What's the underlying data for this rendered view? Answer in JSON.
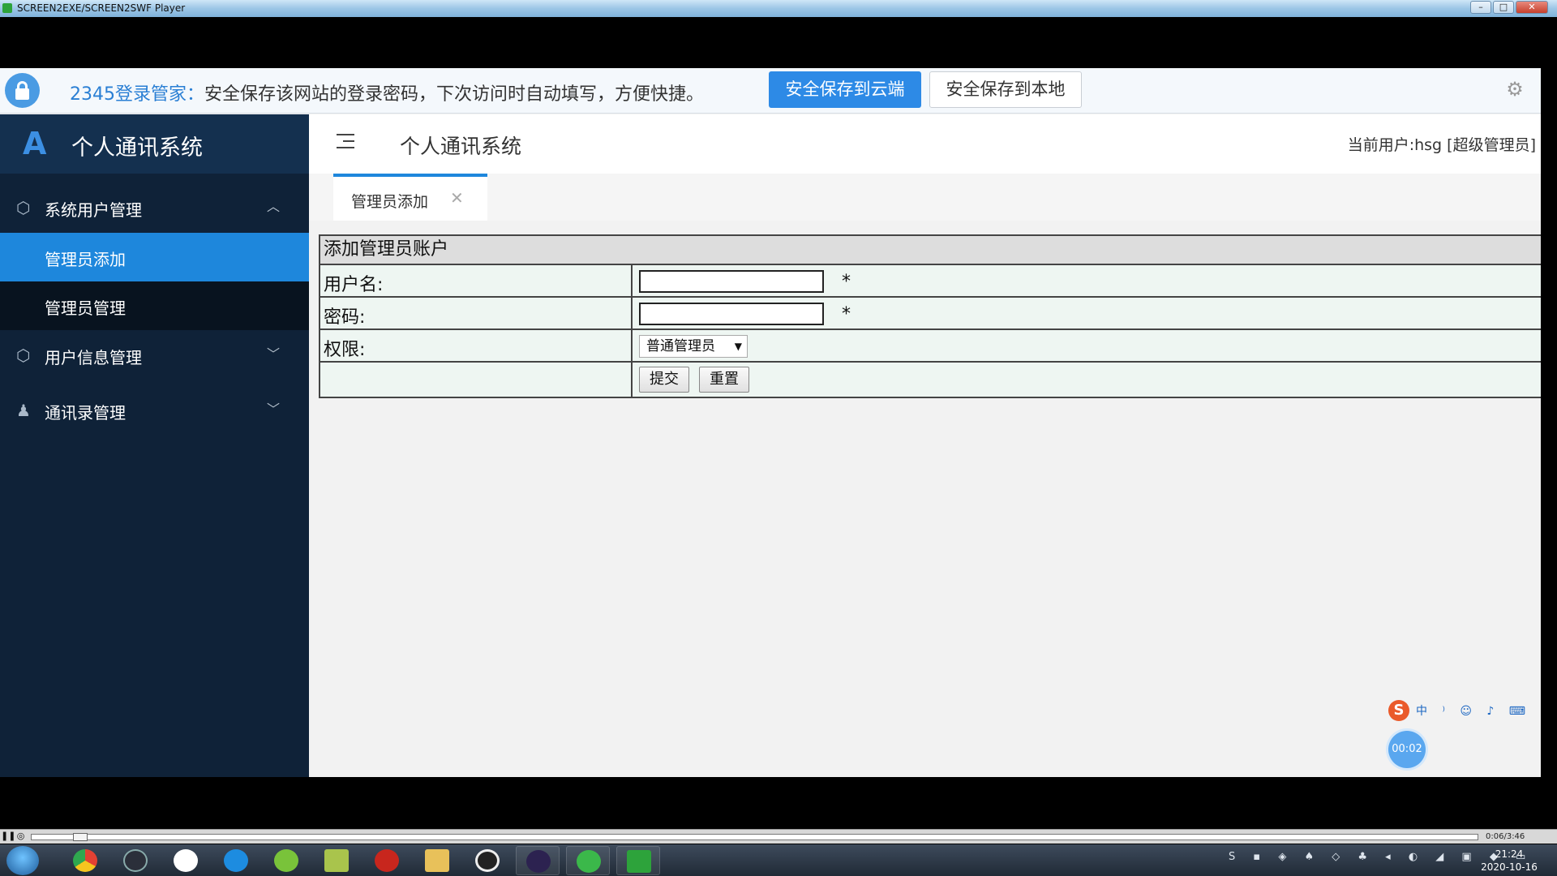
{
  "window": {
    "title": "SCREEN2EXE/SCREEN2SWF Player",
    "min": "–",
    "max": "□",
    "close": "✕"
  },
  "password_bar": {
    "brand": "2345登录管家：",
    "message": "安全保存该网站的登录密码，下次访问时自动填写，方便快捷。",
    "save_cloud": "安全保存到云端",
    "save_local": "安全保存到本地",
    "gear_glyph": "⚙"
  },
  "sidebar": {
    "logo_mark": "A",
    "logo_text": "个人通讯系统",
    "groups": [
      {
        "label": "系统用户管理",
        "icon": "cube-icon",
        "expanded": true
      },
      {
        "label": "用户信息管理",
        "icon": "cube-icon",
        "expanded": false
      },
      {
        "label": "通讯录管理",
        "icon": "user-icon",
        "expanded": false
      }
    ],
    "sub_items": [
      {
        "label": "管理员添加",
        "active": true
      },
      {
        "label": "管理员管理",
        "active": false
      }
    ],
    "arrow_up": "︿",
    "arrow_down": "﹀"
  },
  "topnav": {
    "title": "个人通讯系统",
    "current_user": "当前用户:hsg [超级管理员]"
  },
  "tabs": [
    {
      "label": "管理员添加",
      "close": "✕"
    }
  ],
  "form": {
    "caption": "添加管理员账户",
    "username_label": "用户名:",
    "username_value": "",
    "password_label": "密码:",
    "password_value": "",
    "required_mark": "*",
    "role_label": "权限:",
    "role_selected": "普通管理员",
    "submit": "提交",
    "reset": "重置"
  },
  "overlay": {
    "ime_logo": "S",
    "ime_glyphs": "中 ⁾ ☺ ♪ ⌨ ♙ ⊤ ▦",
    "timer": "00:02"
  },
  "player": {
    "pause": "❚❚",
    "stop": "◎",
    "time": "0:06/3:46",
    "progress": 0.03
  },
  "taskbar": {
    "tray_glyphs": "S ▪ ◈ ♠ ◇ ♣ ◂ ◐ ◢ ▣ ◆ ▭",
    "time": "21:24",
    "date": "2020-10-16"
  },
  "colors": {
    "accent": "#1e87dc",
    "sidebar": "#0f2238",
    "cloud_button": "#2d8ae6"
  }
}
